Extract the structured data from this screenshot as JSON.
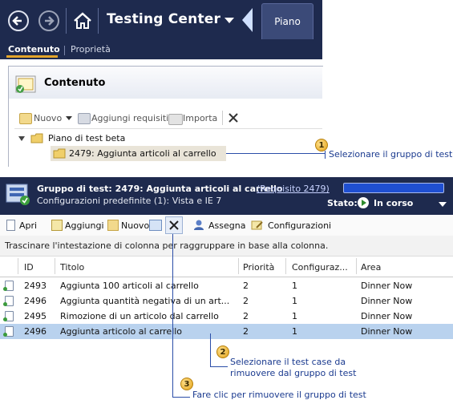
{
  "top": {
    "app_title": "Testing Center",
    "tab_plan": "Piano",
    "tabs": [
      "Contenuto",
      "Proprietà"
    ],
    "content_title": "Contenuto",
    "toolbar": {
      "new": "Nuovo",
      "add_requirements": "Aggiungi requisiti",
      "import": "Importa"
    },
    "tree": {
      "root": "Piano di test beta",
      "selected": "2479: Aggiunta articoli al carrello"
    }
  },
  "callouts": [
    {
      "number": "1",
      "text": "Selezionare il gruppo di test"
    },
    {
      "number": "2",
      "text_line1": "Selezionare il test case da",
      "text_line2": "rimuovere dal gruppo di test"
    },
    {
      "number": "3",
      "text": "Fare clic per rimuovere il gruppo di test"
    }
  ],
  "suite": {
    "title": "Gruppo di test: 2479: Aggiunta articoli al carrello",
    "requirement_link": "(Requisito 2479)",
    "configurations": "Configurazioni predefinite (1): Vista e IE 7",
    "state_label": "Stato:",
    "state_value": "In corso"
  },
  "toolbar2": {
    "open": "Apri",
    "add": "Aggiungi",
    "new": "Nuovo",
    "assign": "Assegna",
    "configurations": "Configurazioni"
  },
  "group_hint": "Trascinare l'intestazione di colonna per raggruppare in base alla colonna.",
  "grid": {
    "headers": [
      "ID",
      "Titolo",
      "Priorità",
      "Configuraz...",
      "Area"
    ],
    "rows": [
      {
        "id": "2493",
        "title": "Aggiunta 100 articoli al carrello",
        "priority": "2",
        "config": "1",
        "area": "Dinner Now"
      },
      {
        "id": "2496",
        "title": "Aggiunta quantità negativa di un art...",
        "priority": "2",
        "config": "1",
        "area": "Dinner Now"
      },
      {
        "id": "2495",
        "title": "Rimozione di un articolo dal carrello",
        "priority": "2",
        "config": "1",
        "area": "Dinner Now"
      },
      {
        "id": "2496",
        "title": "Aggiunta articolo al carrello",
        "priority": "2",
        "config": "1",
        "area": "Dinner Now"
      }
    ]
  },
  "colors": {
    "nav_dark": "#1e2a4e",
    "selection": "#b9d2ee",
    "callout_line": "#2b4ea8",
    "progress": "#1f4fd1",
    "active_tab_underline": "#e3a52a"
  }
}
